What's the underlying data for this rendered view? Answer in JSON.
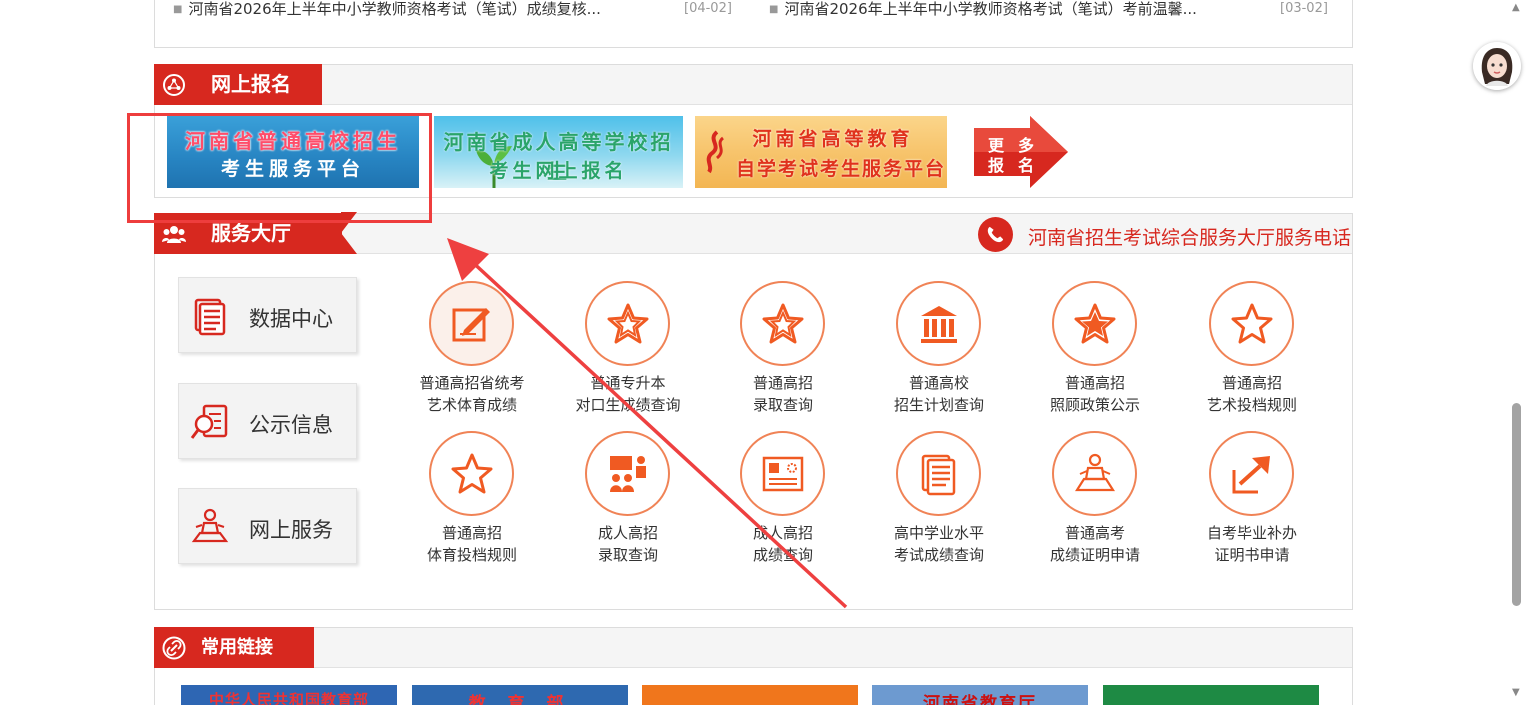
{
  "news": [
    {
      "title": "河南省2026年上半年中小学教师资格考试（笔试）成绩复核...",
      "date": "[04-02]"
    },
    {
      "title": "河南省2026年上半年中小学教师资格考试（笔试）考前温馨...",
      "date": "[03-02]"
    }
  ],
  "online_registration": {
    "title": "网上报名",
    "banners": [
      {
        "line1": "河南省普通高校招生",
        "line2": "考生服务平台"
      },
      {
        "line1": "河南省成人高等学校招生",
        "line2": "考生网上报名"
      },
      {
        "line1": "河南省高等教育",
        "line2": "自学考试考生服务平台"
      }
    ],
    "more": {
      "line1_a": "更",
      "line1_b": "多",
      "line2_a": "报",
      "line2_b": "名"
    }
  },
  "service_hall": {
    "title": "服务大厅",
    "hotline": "河南省招生考试综合服务大厅服务电话",
    "side_buttons": [
      {
        "label": "数据中心",
        "icon": "document-stack-icon"
      },
      {
        "label": "公示信息",
        "icon": "magnifier-document-icon"
      },
      {
        "label": "网上服务",
        "icon": "person-at-desk-icon"
      }
    ],
    "services": [
      {
        "line1": "普通高招省统考",
        "line2": "艺术体育成绩",
        "icon": "edit-note-icon"
      },
      {
        "line1": "普通专升本",
        "line2": "对口生成绩查询",
        "icon": "star-outline-icon"
      },
      {
        "line1": "普通高招",
        "line2": "录取查询",
        "icon": "star-outline-icon"
      },
      {
        "line1": "普通高校",
        "line2": "招生计划查询",
        "icon": "building-columns-icon"
      },
      {
        "line1": "普通高招",
        "line2": "照顾政策公示",
        "icon": "star-filled-icon"
      },
      {
        "line1": "普通高招",
        "line2": "艺术投档规则",
        "icon": "star-outline-icon"
      },
      {
        "line1": "普通高招",
        "line2": "体育投档规则",
        "icon": "star-outline-icon"
      },
      {
        "line1": "成人高招",
        "line2": "录取查询",
        "icon": "group-presentation-icon"
      },
      {
        "line1": "成人高招",
        "line2": "成绩查询",
        "icon": "certificate-icon"
      },
      {
        "line1": "高中学业水平",
        "line2": "考试成绩查询",
        "icon": "document-stack-icon"
      },
      {
        "line1": "普通高考",
        "line2": "成绩证明申请",
        "icon": "person-at-desk-icon"
      },
      {
        "line1": "自考毕业补办",
        "line2": "证明书申请",
        "icon": "export-arrow-icon"
      }
    ]
  },
  "common_links": {
    "title": "常用链接",
    "logos": [
      {
        "text": "中华人民共和国教育部"
      },
      {
        "text": "教 育 部"
      },
      {
        "text": ""
      },
      {
        "text": "河南省教育厅"
      },
      {
        "text": ""
      }
    ]
  },
  "colors": {
    "brand_red": "#d7281f",
    "icon_orange": "#f05a22",
    "highlight": "#ee3d3d"
  }
}
